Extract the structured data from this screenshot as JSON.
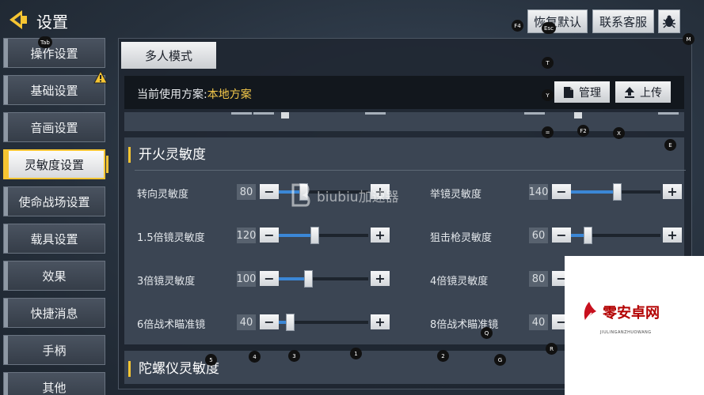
{
  "header": {
    "title": "设置",
    "buttons": {
      "restore_default": "恢复默认",
      "contact_service": "联系客服"
    }
  },
  "hotkeys": {
    "tab": "Tab",
    "f4": "F4",
    "esc": "Esc",
    "m": "M",
    "t": "T",
    "y": "Y",
    "eq": "=",
    "f2": "F2",
    "x": "X",
    "e": "E",
    "k5": "5",
    "k4": "4",
    "k3": "3",
    "k1": "1",
    "k2": "2",
    "g": "G",
    "q": "Q",
    "r": "R"
  },
  "sidebar": {
    "items": [
      {
        "label": "操作设置"
      },
      {
        "label": "基础设置"
      },
      {
        "label": "音画设置"
      },
      {
        "label": "灵敏度设置"
      },
      {
        "label": "使命战场设置"
      },
      {
        "label": "载具设置"
      },
      {
        "label": "效果"
      },
      {
        "label": "快捷消息"
      },
      {
        "label": "手柄"
      },
      {
        "label": "其他"
      }
    ],
    "active_index": 3
  },
  "main": {
    "mode_tab": "多人模式",
    "scheme_label": "当前使用方案:",
    "scheme_value": "本地方案",
    "manage_label": "管理",
    "upload_label": "上传",
    "section_fire": "开火灵敏度",
    "section_gyro": "陀螺仪灵敏度",
    "sliders": [
      {
        "label": "转向灵敏度",
        "value": "80",
        "fraction": 0.27
      },
      {
        "label": "举镜灵敏度",
        "value": "140",
        "fraction": 0.51
      },
      {
        "label": "1.5倍镜灵敏度",
        "value": "120",
        "fraction": 0.4
      },
      {
        "label": "狙击枪灵敏度",
        "value": "60",
        "fraction": 0.19
      },
      {
        "label": "3倍镜灵敏度",
        "value": "100",
        "fraction": 0.33
      },
      {
        "label": "4倍镜灵敏度",
        "value": "80",
        "fraction": 0.27
      },
      {
        "label": "6倍战术瞄准镜",
        "value": "40",
        "fraction": 0.12
      },
      {
        "label": "8倍战术瞄准镜",
        "value": "40",
        "fraction": 0.12
      }
    ]
  },
  "watermark": {
    "text": "biubiu加速器"
  },
  "overlay": {
    "text": "零安卓网",
    "sub": "JIULINGANZHUOWANG"
  },
  "colors": {
    "accent": "#f6c532",
    "fill": "#3b87d6",
    "scheme_value": "#f4c84a"
  }
}
